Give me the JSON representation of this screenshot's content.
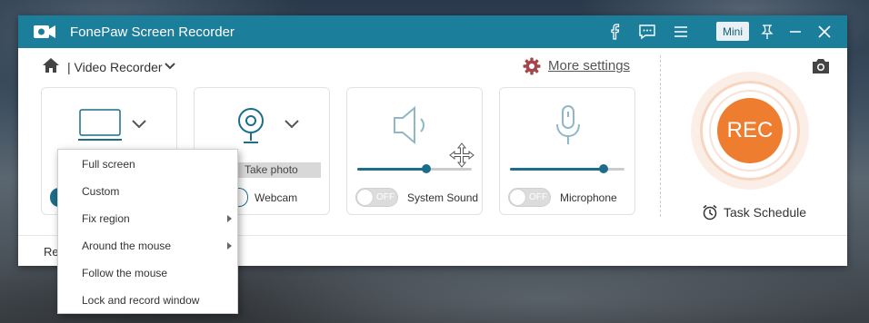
{
  "app": {
    "title": "FonePaw Screen Recorder",
    "mini_label": "Mini",
    "accent_color": "#1b7e9b",
    "rec_color": "#ee7d2f"
  },
  "toolbar": {
    "mode_label": "| Video Recorder",
    "more_settings": "More settings"
  },
  "panels": {
    "display": {
      "toggle_state": "on"
    },
    "webcam": {
      "take_photo": "Take photo",
      "label": "Webcam",
      "toggle_state": "on"
    },
    "system_sound": {
      "label": "System Sound",
      "toggle_text": "OFF",
      "volume": 0.6
    },
    "microphone": {
      "label": "Microphone",
      "toggle_text": "OFF",
      "volume": 0.82
    }
  },
  "rec": {
    "label": "REC",
    "task_schedule": "Task Schedule"
  },
  "bottom": {
    "text": "Re"
  },
  "dropdown": {
    "items": [
      {
        "label": "Full screen",
        "submenu": false
      },
      {
        "label": "Custom",
        "submenu": false
      },
      {
        "label": "Fix region",
        "submenu": true
      },
      {
        "label": "Around the mouse",
        "submenu": true
      },
      {
        "label": "Follow the mouse",
        "submenu": false
      },
      {
        "label": "Lock and record window",
        "submenu": false
      }
    ]
  }
}
